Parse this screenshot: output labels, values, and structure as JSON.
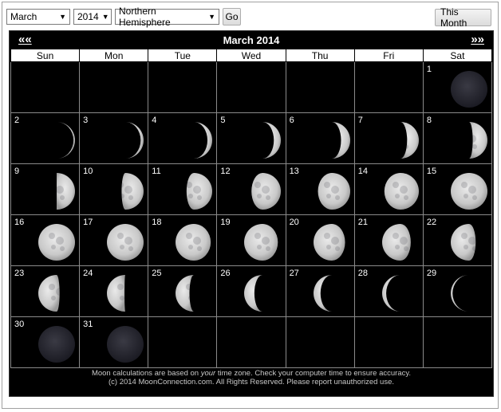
{
  "controls": {
    "month": "March",
    "year": "2014",
    "hemisphere": "Northern Hemisphere",
    "go_label": "Go",
    "this_month_label": "This Month"
  },
  "calendar": {
    "title": "March 2014",
    "prev_label": "««",
    "next_label": "»»",
    "weekdays": [
      "Sun",
      "Mon",
      "Tue",
      "Wed",
      "Thu",
      "Fri",
      "Sat"
    ],
    "weeks": [
      [
        null,
        null,
        null,
        null,
        null,
        null,
        {
          "day": "1",
          "phase": 0.01
        }
      ],
      [
        {
          "day": "2",
          "phase": 0.04
        },
        {
          "day": "3",
          "phase": 0.08
        },
        {
          "day": "4",
          "phase": 0.13
        },
        {
          "day": "5",
          "phase": 0.19
        },
        {
          "day": "6",
          "phase": 0.25
        },
        {
          "day": "7",
          "phase": 0.32
        },
        {
          "day": "8",
          "phase": 0.4
        }
      ],
      [
        {
          "day": "9",
          "phase": 0.5
        },
        {
          "day": "10",
          "phase": 0.6
        },
        {
          "day": "11",
          "phase": 0.7
        },
        {
          "day": "12",
          "phase": 0.8
        },
        {
          "day": "13",
          "phase": 0.88
        },
        {
          "day": "14",
          "phase": 0.94
        },
        {
          "day": "15",
          "phase": 0.98
        }
      ],
      [
        {
          "day": "16",
          "phase": 1.0
        },
        {
          "day": "17",
          "phase": 0.99
        },
        {
          "day": "18",
          "phase": 0.96
        },
        {
          "day": "19",
          "phase": 0.92
        },
        {
          "day": "20",
          "phase": 0.86
        },
        {
          "day": "21",
          "phase": 0.78
        },
        {
          "day": "22",
          "phase": 0.68
        }
      ],
      [
        {
          "day": "23",
          "phase": 0.58
        },
        {
          "day": "24",
          "phase": 0.48
        },
        {
          "day": "25",
          "phase": 0.38
        },
        {
          "day": "26",
          "phase": 0.28
        },
        {
          "day": "27",
          "phase": 0.19
        },
        {
          "day": "28",
          "phase": 0.11
        },
        {
          "day": "29",
          "phase": 0.05
        }
      ],
      [
        {
          "day": "30",
          "phase": 0.02
        },
        {
          "day": "31",
          "phase": 0.0
        },
        null,
        null,
        null,
        null,
        null
      ]
    ],
    "waxing_until_day": 16,
    "footer_line1_pre": "Moon calculations are based on ",
    "footer_line1_em": "your",
    "footer_line1_post": " time zone. Check your computer time to ensure accuracy.",
    "footer_line2": "(c) 2014 MoonConnection.com. All Rights Reserved. Please report unauthorized use."
  }
}
